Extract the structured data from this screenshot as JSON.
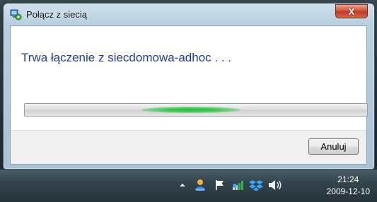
{
  "window": {
    "title": "Połącz z siecią",
    "close_label": "X",
    "status_text": "Trwa łączenie z siecdomowa-adhoc . . .",
    "progress": {
      "state": "indeterminate"
    },
    "cancel_label": "Anuluj"
  },
  "taskbar": {
    "tray_icons": [
      "show-hidden-icons-arrow",
      "network-icon",
      "action-center-flag-icon",
      "network-signal-icon",
      "dropbox-icon",
      "volume-icon"
    ],
    "clock": {
      "time": "21:24",
      "date": "2009-12-10"
    }
  }
}
